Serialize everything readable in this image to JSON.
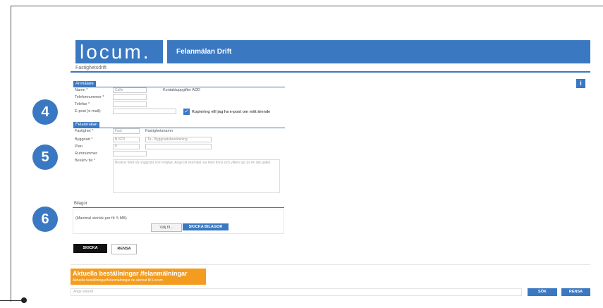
{
  "brand": {
    "logo_text": "locum.",
    "logo_sub": "Fastighetsdrift"
  },
  "header": {
    "title": "Felanmälan Drift"
  },
  "info_icon": "i",
  "badges": [
    "4",
    "5",
    "6"
  ],
  "sections": {
    "contact": {
      "title": "Anmälare",
      "name_label": "Namn *",
      "name_value": "Calle",
      "name_extra": "Kontaktuppgifter ADD",
      "phone_label": "Telefonnummer *",
      "fax_label": "Telefax *",
      "email_label": "E-post (e-mail):",
      "email_value": "",
      "copy_label": "Kopiering vill jag ha e-post om mitt ärende"
    },
    "report": {
      "title": "Felanmälan",
      "property_label": "Fastighet *",
      "property_value": "Fast",
      "property_extra": "Fastighetsnamn",
      "building_label": "Byggnad *",
      "building_value": "B-ST0",
      "building_extra": "Ta - Byggnadsbenämning",
      "floor_label": "Plan",
      "floor_value": "0",
      "room_label": "Rumnummer",
      "room_value": "",
      "desc_label": "Beskriv fel *",
      "desc_placeholder": "Beskriv felet så noggrant som möjligt. Ange till exempel var felet finns och vilken typ av fel det gäller."
    }
  },
  "attachments": {
    "title": "Bilagor",
    "note": "(Maximal storlek per fil: 5 MB)",
    "choose_label": "Välj fil...",
    "send_label": "SKICKA BILAGOR"
  },
  "form_buttons": {
    "submit": "SKICKA",
    "clear": "RENSA"
  },
  "orders": {
    "title": "Aktuella beställningar /felanmälningar",
    "subtitle": "Aktuella beställningar/felanmälningar du skickat till Locum"
  },
  "search": {
    "placeholder": "Ange sökord",
    "search_button": "SÖK",
    "clear_button": "RENSA"
  }
}
